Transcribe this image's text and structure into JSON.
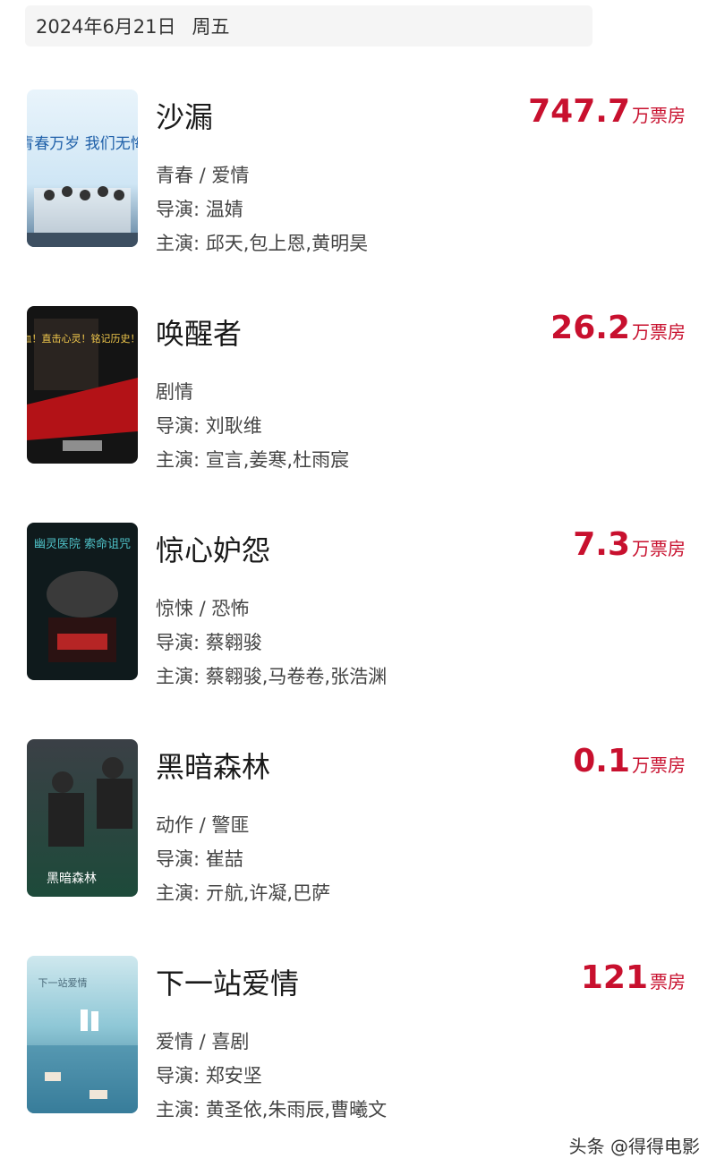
{
  "header": {
    "date": "2024年6月21日",
    "weekday": "周五"
  },
  "movies": [
    {
      "title": "沙漏",
      "box_value": "747.7",
      "box_unit": "万票房",
      "genre": "青春 / 爱情",
      "director": "导演: 温婧",
      "cast": "主演: 邱天,包上恩,黄明昊",
      "poster_text": "青春万岁 我们无悔"
    },
    {
      "title": "唤醒者",
      "box_value": "26.2",
      "box_unit": "万票房",
      "genre": "剧情",
      "director": "导演: 刘耿维",
      "cast": "主演: 宣言,姜寒,杜雨宸",
      "poster_text": "高燃热血！直击心灵！铭记历史！"
    },
    {
      "title": "惊心妒怨",
      "box_value": "7.3",
      "box_unit": "万票房",
      "genre": "惊悚 / 恐怖",
      "director": "导演: 蔡翱骏",
      "cast": "主演: 蔡翱骏,马卷卷,张浩渊",
      "poster_text": "幽灵医院 索命诅咒"
    },
    {
      "title": "黑暗森林",
      "box_value": "0.1",
      "box_unit": "万票房",
      "genre": "动作 / 警匪",
      "director": "导演: 崔喆",
      "cast": "主演: 亓航,许凝,巴萨",
      "poster_text": "黑暗森林"
    },
    {
      "title": "下一站爱情",
      "box_value": "121",
      "box_unit": "票房",
      "genre": "爱情 / 喜剧",
      "director": "导演: 郑安坚",
      "cast": "主演: 黄圣依,朱雨辰,曹曦文",
      "poster_text": "下一站爱情"
    }
  ],
  "watermark": "头条 @得得电影",
  "colors": {
    "accent": "#c8102e",
    "date_bar_bg": "#f5f5f5"
  }
}
